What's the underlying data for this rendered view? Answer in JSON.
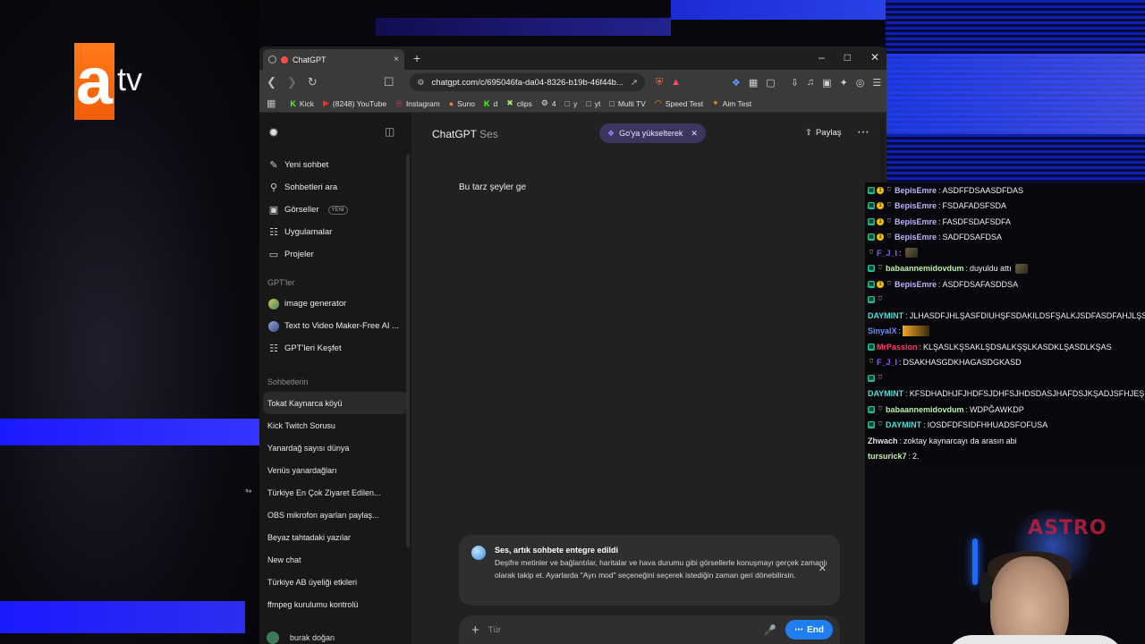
{
  "stream_logo": {
    "brand_a": "a",
    "brand_tv": "tv"
  },
  "browser": {
    "tab_title": "ChatGPT",
    "tab_close": "×",
    "new_tab": "+",
    "url": "chatgpt.com/c/695046fa-da04-8326-b19b-46f44b...",
    "bookmarks": [
      {
        "label": "Kick",
        "icon": "kick-icon"
      },
      {
        "label": "(8248) YouTube",
        "icon": "youtube-icon"
      },
      {
        "label": "Instagram",
        "icon": "instagram-icon"
      },
      {
        "label": "Suno",
        "icon": "suno-icon"
      },
      {
        "label": "d",
        "icon": "kick-icon"
      },
      {
        "label": "clips",
        "icon": "clips-icon"
      },
      {
        "label": "4",
        "icon": "settings-icon"
      },
      {
        "label": "y",
        "icon": "folder-icon"
      },
      {
        "label": "yt",
        "icon": "folder-icon"
      },
      {
        "label": "Multi TV",
        "icon": "folder-icon"
      },
      {
        "label": "Speed Test",
        "icon": "speed-icon"
      },
      {
        "label": "Aim Test",
        "icon": "aim-icon"
      }
    ]
  },
  "sidebar": {
    "items": [
      {
        "label": "Yeni sohbet",
        "icon": "edit-icon"
      },
      {
        "label": "Sohbetleri ara",
        "icon": "search-icon"
      },
      {
        "label": "Görseller",
        "icon": "image-icon",
        "badge": "YENİ"
      },
      {
        "label": "Uygulamalar",
        "icon": "apps-icon"
      },
      {
        "label": "Projeler",
        "icon": "folder-icon"
      }
    ],
    "gpts_heading": "GPT'ler",
    "gpts": [
      {
        "label": "image generator"
      },
      {
        "label": "Text to Video Maker-Free AI ..."
      },
      {
        "label": "GPT'leri Keşfet"
      }
    ],
    "chats_heading": "Sohbetlerin",
    "chats": [
      "Tokat Kaynarca köyü",
      "Kick Twitch Sorusu",
      "Yanardağ sayısı dünya",
      "Venüs yanardağları",
      "Türkiye En Çok Ziyaret Edilen...",
      "OBS mikrofon ayarları paylaş...",
      "Beyaz tahtadaki yazılar",
      "New chat",
      "Türkiye AB üyeliği etkileri",
      "ffmpeg kurulumu kontrolü"
    ],
    "user_name": "burak doğan"
  },
  "main": {
    "model_name": "ChatGPT",
    "model_sub": "Ses",
    "upgrade_label": "Go'ya yükseltere",
    "upgrade_label_tail": "k",
    "share_label": "Paylaş",
    "user_message": "Bu tarz şeyler ge",
    "notice": {
      "title": "Ses, artık sohbete entegre edildi",
      "body": "Deşifre metinler ve bağlantılar, haritalar ve hava durumu gibi görsellerle konuşmayı gerçek zamanlı olarak takip et. Ayarlarda \"Ayrı mod\" seçeneğini seçerek istediğin zaman geri dönebilirsin."
    },
    "composer_placeholder": "Tür",
    "end_label": "End"
  },
  "stream_chat": [
    {
      "name": "BepisEmre",
      "color": "#b9b5ff",
      "text": "ASDFFDSAASDFDAS",
      "badges": [
        "g",
        "y",
        "s"
      ]
    },
    {
      "name": "BepisEmre",
      "color": "#b9b5ff",
      "text": "FSDAFADSFSDA",
      "badges": [
        "g",
        "y",
        "s"
      ]
    },
    {
      "name": "BepisEmre",
      "color": "#b9b5ff",
      "text": "FASDFSDAFSDFA",
      "badges": [
        "g",
        "y",
        "s"
      ]
    },
    {
      "name": "BepisEmre",
      "color": "#b9b5ff",
      "text": "SADFDSAFDSA",
      "badges": [
        "g",
        "y",
        "s"
      ]
    },
    {
      "name": "F_J_I",
      "color": "#8a5cff",
      "text": "",
      "badges": [
        "s"
      ],
      "emote": true
    },
    {
      "name": "babaannemidovdum",
      "color": "#b9f0a6",
      "text": "duyuldu attı",
      "badges": [
        "g",
        "s"
      ],
      "emote": true
    },
    {
      "name": "BepisEmre",
      "color": "#b9b5ff",
      "text": "ASDFDSAFASDDSA",
      "badges": [
        "g",
        "y",
        "s"
      ]
    },
    {
      "name": "",
      "color": "#ffffff",
      "text": "",
      "badges": [
        "g",
        "s"
      ]
    },
    {
      "name": "DAYMINT",
      "color": "#47e0d6",
      "text": "JLHASDFJHLŞASFDIUHŞFSDAKILDSFŞALKJSDFASDFAHJLŞSF",
      "badges": []
    },
    {
      "name": "SinyalX",
      "color": "#6b8cff",
      "text": "",
      "badges": [],
      "emote_big": true
    },
    {
      "name": "MrPassion",
      "color": "#ff3b6b",
      "text": "KLŞASLKŞSAKLŞDSALKŞŞLKASDKLŞASDLKŞAS",
      "badges": [
        "g"
      ]
    },
    {
      "name": "F_J_I",
      "color": "#8a5cff",
      "text": "DSAKHASGDKHAGASDGKASD",
      "badges": [
        "s"
      ]
    },
    {
      "name": "",
      "color": "#ffffff",
      "text": "",
      "badges": [
        "g",
        "s"
      ]
    },
    {
      "name": "DAYMINT",
      "color": "#47e0d6",
      "text": "KFSDHADHJFJHDFSJDHFSJHDSDASJHAFDSJKŞADJSFHJEŞF",
      "badges": []
    },
    {
      "name": "babaannemidovdum",
      "color": "#b9f0a6",
      "text": "WDPĞAWKDP",
      "badges": [
        "g",
        "s"
      ]
    },
    {
      "name": "DAYMINT",
      "color": "#47e0d6",
      "text": "IOSDFDFSIDFHHUADSFOFUSA",
      "badges": [
        "g",
        "s"
      ]
    },
    {
      "name": "Zhwach",
      "color": "#e0e0e0",
      "text": "zoktay kaynarcayı da arasın abi",
      "badges": []
    },
    {
      "name": "tursurick7",
      "color": "#c8f5a0",
      "text": "2.",
      "badges": []
    }
  ],
  "colors": {
    "accent_blue": "#1f7ff0",
    "upgrade_bg": "#3b3560",
    "atv_orange": "#f25c05"
  }
}
